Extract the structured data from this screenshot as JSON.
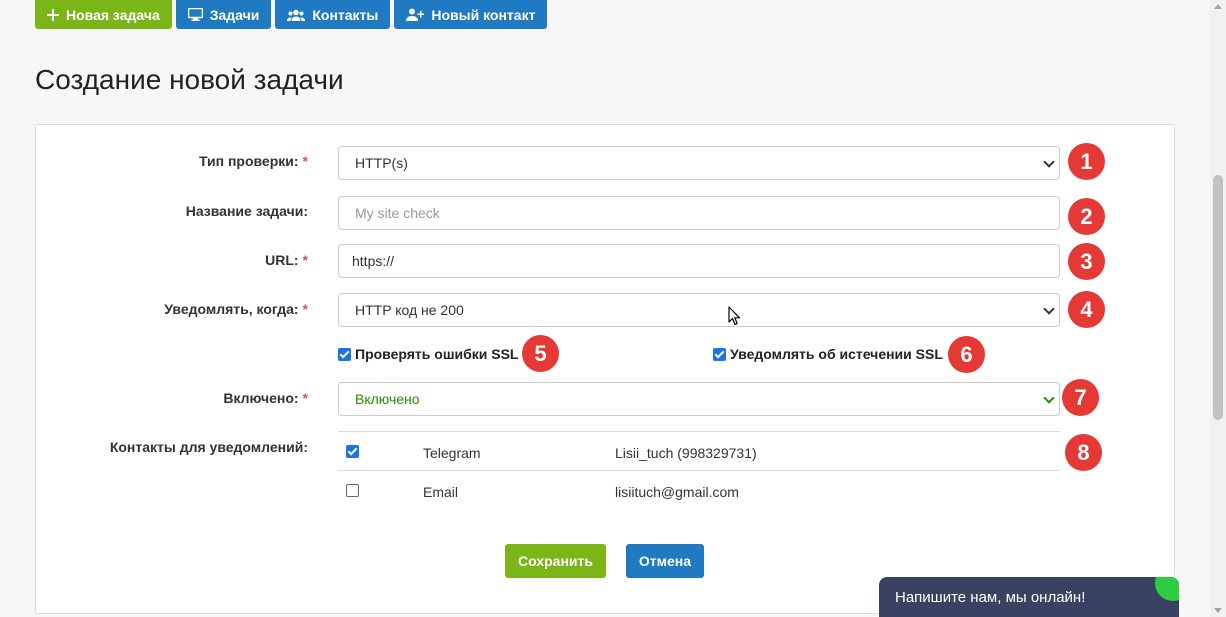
{
  "toolbar": {
    "new_task": "Новая задача",
    "tasks": "Задачи",
    "contacts": "Контакты",
    "new_contact": "Новый контакт"
  },
  "page": {
    "title": "Создание новой задачи"
  },
  "form": {
    "check_type": {
      "label": "Тип проверки:",
      "required": "*",
      "value": "HTTP(s)",
      "badge": "1"
    },
    "task_name": {
      "label": "Название задачи:",
      "placeholder": "My site check",
      "badge": "2"
    },
    "url": {
      "label": "URL:",
      "required": "*",
      "value": "https://",
      "badge": "3"
    },
    "notify_when": {
      "label": "Уведомлять, когда:",
      "required": "*",
      "value": "HTTP код не 200",
      "badge": "4"
    },
    "ssl_errors": {
      "label": "Проверять ошибки SSL",
      "checked": true,
      "badge": "5"
    },
    "ssl_expiry": {
      "label": "Уведомлять об истечении SSL",
      "checked": true,
      "badge": "6"
    },
    "enabled": {
      "label": "Включено:",
      "required": "*",
      "value": "Включено",
      "badge": "7"
    },
    "contacts": {
      "label": "Контакты для уведомлений:",
      "badge": "8",
      "rows": [
        {
          "type": "Telegram",
          "value": "Lisii_tuch (998329731)",
          "checked": true
        },
        {
          "type": "Email",
          "value": "lisiituch@gmail.com",
          "checked": false
        }
      ]
    },
    "save": "Сохранить",
    "cancel": "Отмена"
  },
  "chat": {
    "text": "Напишите нам, мы онлайн!"
  },
  "colors": {
    "green": "#7cb518",
    "blue": "#1f7ac2",
    "badge": "#e53935",
    "chat": "#3a4262"
  },
  "icons": [
    "plus-icon",
    "monitor-icon",
    "users-icon",
    "user-plus-icon",
    "chevron-down-icon",
    "mouse-cursor-icon"
  ]
}
